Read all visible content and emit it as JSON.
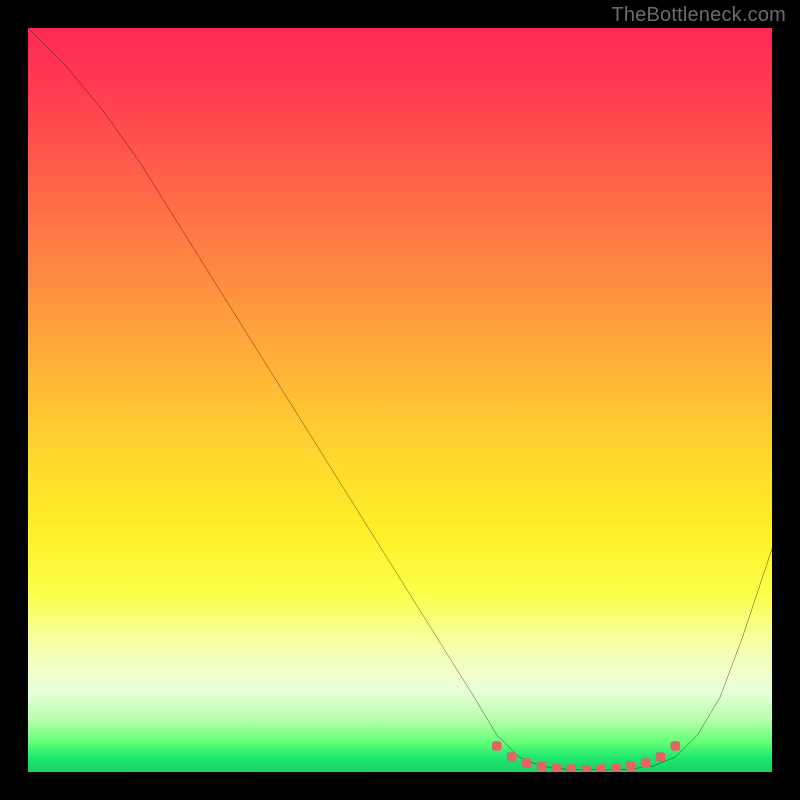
{
  "attribution": "TheBottleneck.com",
  "colors": {
    "background": "#000000",
    "curve": "#000000",
    "markers": "#e06666",
    "gradient_top": "#ff2a54",
    "gradient_bottom": "#18d264"
  },
  "chart_data": {
    "type": "line",
    "title": "",
    "xlabel": "",
    "ylabel": "",
    "xlim": [
      0,
      100
    ],
    "ylim": [
      0,
      100
    ],
    "series": [
      {
        "name": "bottleneck-curve",
        "x": [
          0,
          5,
          10,
          15,
          20,
          25,
          30,
          35,
          40,
          45,
          50,
          55,
          60,
          63,
          66,
          69,
          72,
          75,
          78,
          81,
          84,
          87,
          90,
          93,
          96,
          100
        ],
        "y": [
          100,
          95,
          89,
          82,
          74,
          66,
          58,
          50,
          42,
          34,
          26,
          18,
          10,
          5,
          2,
          0.8,
          0.4,
          0.3,
          0.3,
          0.4,
          0.8,
          2,
          5,
          10,
          18,
          30
        ]
      }
    ],
    "markers": {
      "name": "optimal-range",
      "x": [
        63,
        65,
        67,
        69,
        71,
        73,
        75,
        77,
        79,
        81,
        83,
        85,
        87
      ],
      "y": [
        3.5,
        2.0,
        1.2,
        0.8,
        0.5,
        0.4,
        0.3,
        0.4,
        0.5,
        0.8,
        1.2,
        2.0,
        3.5
      ]
    }
  }
}
